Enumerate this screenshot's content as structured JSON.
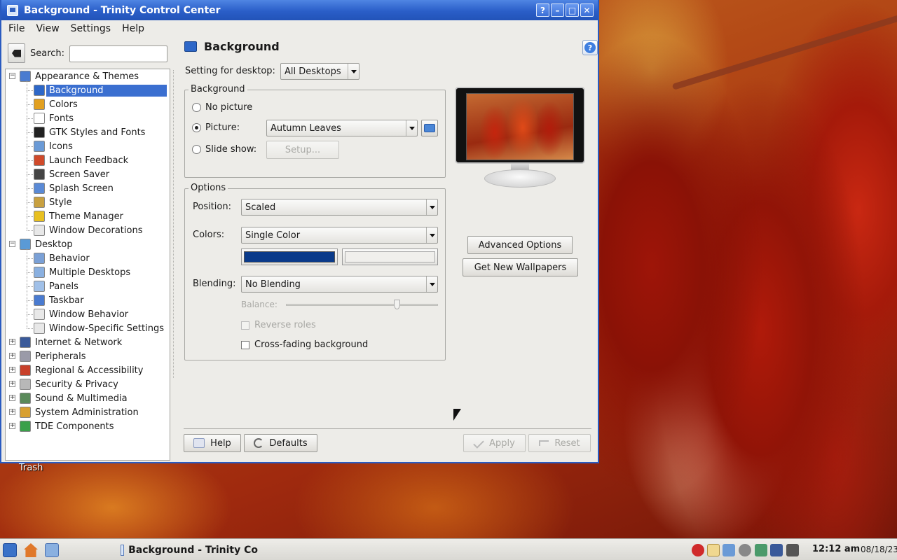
{
  "window": {
    "title": "Background - Trinity Control Center",
    "title_buttons": [
      "?",
      "–",
      "□",
      "✕"
    ]
  },
  "menubar": [
    "File",
    "View",
    "Settings",
    "Help"
  ],
  "sidebar": {
    "search_label": "Search:",
    "search_value": "",
    "tree": [
      {
        "label": "Appearance & Themes",
        "level": 0,
        "expander": "−",
        "icon": "appearance-icon",
        "color": "#4a7bd0"
      },
      {
        "label": "Background",
        "level": 1,
        "icon": "background-icon",
        "color": "#2d67c8",
        "selected": true
      },
      {
        "label": "Colors",
        "level": 1,
        "icon": "colors-icon",
        "color": "#e2a020"
      },
      {
        "label": "Fonts",
        "level": 1,
        "icon": "fonts-icon",
        "color": "#ffffff"
      },
      {
        "label": "GTK Styles and Fonts",
        "level": 1,
        "icon": "gtk-icon",
        "color": "#222222"
      },
      {
        "label": "Icons",
        "level": 1,
        "icon": "icons-icon",
        "color": "#6a9ad6"
      },
      {
        "label": "Launch Feedback",
        "level": 1,
        "icon": "launch-feedback-icon",
        "color": "#d04a2a"
      },
      {
        "label": "Screen Saver",
        "level": 1,
        "icon": "screensaver-icon",
        "color": "#444444"
      },
      {
        "label": "Splash Screen",
        "level": 1,
        "icon": "splash-icon",
        "color": "#5a8ad6"
      },
      {
        "label": "Style",
        "level": 1,
        "icon": "style-icon",
        "color": "#c8a040"
      },
      {
        "label": "Theme Manager",
        "level": 1,
        "icon": "theme-manager-icon",
        "color": "#e8c020"
      },
      {
        "label": "Window Decorations",
        "level": 1,
        "icon": "window-decorations-icon",
        "color": "#e8e8e8"
      },
      {
        "label": "Desktop",
        "level": 0,
        "expander": "−",
        "icon": "desktop-icon",
        "color": "#5a9ad6"
      },
      {
        "label": "Behavior",
        "level": 1,
        "icon": "behavior-icon",
        "color": "#7aa0d6"
      },
      {
        "label": "Multiple Desktops",
        "level": 1,
        "icon": "multiple-desktops-icon",
        "color": "#8ab0e0"
      },
      {
        "label": "Panels",
        "level": 1,
        "icon": "panels-icon",
        "color": "#a0c0e8"
      },
      {
        "label": "Taskbar",
        "level": 1,
        "icon": "taskbar-icon",
        "color": "#4a7bd0"
      },
      {
        "label": "Window Behavior",
        "level": 1,
        "icon": "window-behavior-icon",
        "color": "#e8e8e8"
      },
      {
        "label": "Window-Specific Settings",
        "level": 1,
        "icon": "window-specific-icon",
        "color": "#e8e8e8"
      },
      {
        "label": "Internet & Network",
        "level": 0,
        "expander": "+",
        "icon": "internet-icon",
        "color": "#3a5a9a"
      },
      {
        "label": "Peripherals",
        "level": 0,
        "expander": "+",
        "icon": "peripherals-icon",
        "color": "#9a9aa8"
      },
      {
        "label": "Regional & Accessibility",
        "level": 0,
        "expander": "+",
        "icon": "regional-icon",
        "color": "#c8402a"
      },
      {
        "label": "Security & Privacy",
        "level": 0,
        "expander": "+",
        "icon": "security-icon",
        "color": "#b8b8b8"
      },
      {
        "label": "Sound & Multimedia",
        "level": 0,
        "expander": "+",
        "icon": "sound-icon",
        "color": "#5a8a5a"
      },
      {
        "label": "System Administration",
        "level": 0,
        "expander": "+",
        "icon": "system-admin-icon",
        "color": "#d8a030"
      },
      {
        "label": "TDE Components",
        "level": 0,
        "expander": "+",
        "icon": "tde-components-icon",
        "color": "#3aa04a"
      }
    ]
  },
  "content": {
    "header_title": "Background",
    "desktop_label": "Setting for desktop:",
    "desktop_value": "All Desktops",
    "background_group": {
      "title": "Background",
      "no_picture": "No picture",
      "picture": "Picture:",
      "picture_value": "Autumn Leaves",
      "slide_show": "Slide show:",
      "setup": "Setup...",
      "selected": "picture"
    },
    "options_group": {
      "title": "Options",
      "position_label": "Position:",
      "position_value": "Scaled",
      "colors_label": "Colors:",
      "colors_value": "Single Color",
      "color1": "#0a3a8a",
      "color2": "#f0efec",
      "blending_label": "Blending:",
      "blending_value": "No Blending",
      "balance_label": "Balance:",
      "balance_level": 0.73,
      "reverse_roles": "Reverse roles",
      "cross_fading": "Cross-fading background"
    },
    "advanced_options": "Advanced Options",
    "get_new_wallpapers": "Get New Wallpapers",
    "buttons": {
      "help": "Help",
      "defaults": "Defaults",
      "apply": "Apply",
      "reset": "Reset"
    }
  },
  "desktop": {
    "trash_label": "Trash"
  },
  "taskbar": {
    "task_label": "Background - Trinity Co",
    "clock": "12:12 am",
    "date": "08/18/23"
  }
}
